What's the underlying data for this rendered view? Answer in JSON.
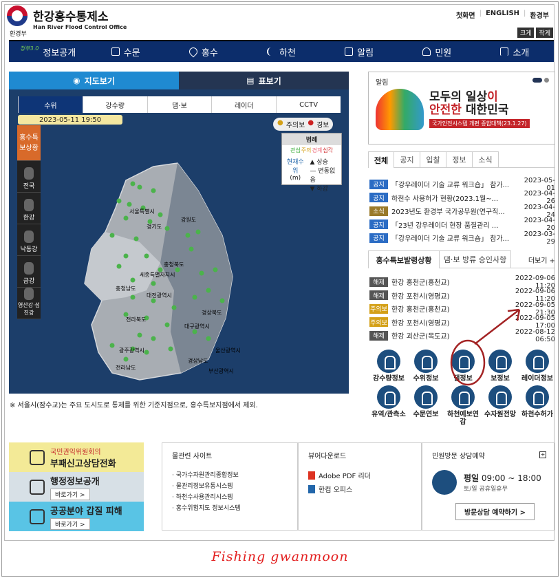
{
  "header": {
    "ministry": "환경부",
    "title_ko": "한강홍수통제소",
    "title_en": "Han River Flood Control Office"
  },
  "topnav": {
    "home": "첫화면",
    "english": "ENGLISH",
    "ministry": "환경부",
    "size_up": "크게",
    "size_down": "작게"
  },
  "gnb": {
    "open_small": "정부3.0",
    "items": [
      "정보공개",
      "수문",
      "홍수",
      "하천",
      "알림",
      "민원",
      "소개"
    ]
  },
  "map": {
    "tab_map": "지도보기",
    "tab_table": "표보기",
    "subtabs": [
      "수위",
      "강수량",
      "댐·보",
      "레이더",
      "CCTV"
    ],
    "datetime": "2023-05-11 19:50",
    "alert_attention": "주의보",
    "alert_warning": "경보",
    "legend": {
      "title": "범례",
      "levels": [
        "관심",
        "주의",
        "경계",
        "심각"
      ],
      "current": "현재수위",
      "unit": "(m)",
      "up": "▲ 상승",
      "same": "— 변동없음",
      "down": "▼ 하강"
    },
    "side": [
      "홍수특보상황",
      "전국",
      "한강",
      "낙동강",
      "금강",
      "영산강·섬진강"
    ],
    "regions": [
      "서울특별시",
      "경기도",
      "강원도",
      "충청북도",
      "충청남도",
      "세종특별자치시",
      "대전광역시",
      "경상북도",
      "대구광역시",
      "전라북도",
      "울산광역시",
      "광주광역시",
      "경상남도",
      "부산광역시",
      "전라남도"
    ],
    "footnote": "※ 서울시(잠수교)는 주요 도시도로 통제를 위한 기준지점으로, 홍수특보지점에서 제외."
  },
  "banner": {
    "title": "알림",
    "line1a": "모두의 일상",
    "line1b": "이",
    "line2a": "안전한",
    "line2b": " 대한민국",
    "sub": "국가안전시스템 개편 종합대책(23.1.27)"
  },
  "notice": {
    "tabs": [
      "전체",
      "공지",
      "입찰",
      "정보",
      "소식"
    ],
    "items": [
      {
        "tag": "공지",
        "title": "「강우레이더 기술 교류 워크숍」 참가...",
        "date": "2023-05-01"
      },
      {
        "tag": "공지",
        "title": "하천수 사용허가 현황(2023.1월~...",
        "date": "2023-04-26"
      },
      {
        "tag": "소식",
        "title": "2023년도 환경부 국가공무원(연구직...",
        "date": "2023-04-24"
      },
      {
        "tag": "공지",
        "title": "「23년 강우레이더 현장 품질관리 ...",
        "date": "2023-04-20"
      },
      {
        "tag": "공지",
        "title": "「강우레이더 기술 교류 워크숍」 참가...",
        "date": "2023-03-29"
      }
    ]
  },
  "flood": {
    "tab1": "홍수특보발령상황",
    "tab2": "댐·보 방류 승인사항",
    "more": "더보기 +",
    "items": [
      {
        "tag": "해제",
        "title": "한강 홍천군(홍천교)",
        "date": "2022-09-06 11:20"
      },
      {
        "tag": "해제",
        "title": "한강 포천시(영평교)",
        "date": "2022-09-06 11:20"
      },
      {
        "tag": "주의보",
        "title": "한강 홍천군(홍천교)",
        "date": "2022-09-05 21:30"
      },
      {
        "tag": "주의보",
        "title": "한강 포천시(영평교)",
        "date": "2022-09-05 17:00"
      },
      {
        "tag": "해제",
        "title": "한강 괴산군(목도교)",
        "date": "2022-08-12 06:50"
      }
    ]
  },
  "quick": [
    "강수량정보",
    "수위정보",
    "댐정보",
    "보정보",
    "레이더정보",
    "유역/관측소",
    "수문연보",
    "하천예보연감",
    "수자원전망",
    "하천수허가"
  ],
  "bottom": {
    "b1_sub": "국민권익위원회의",
    "b1_title": "부패신고상담전화",
    "b2_title": "행정정보공개",
    "b2_go": "바로가기 >",
    "b3_title": "공공분야 갑질 피해",
    "b3_go": "바로가기 >",
    "sites_title": "물관련 사이트",
    "sites": [
      "국가수자원관리종합정보",
      "물관리정보유통시스템",
      "하천수사용관리시스템",
      "홍수위험지도 정보시스템"
    ],
    "viewer_title": "뷰어다운로드",
    "viewer1": "Adobe PDF 리더",
    "viewer2": "한컴 오피스",
    "visit_title": "민원방문 상담예약",
    "visit_day": "평일",
    "visit_time": "09:00 ~ 18:00",
    "visit_off": "토/일 공휴일휴무",
    "visit_btn": "방문상담 예약하기 >"
  },
  "signature": "Fishing   gwanmoon",
  "colors": {
    "navy": "#0c2d6b",
    "map_bg": "#1c3e6a",
    "tag_notice": "#2b6cc4",
    "tag_news": "#9a7a2a",
    "tag_release": "#555",
    "tag_attention": "#d4a017",
    "annotation": "#a32324"
  }
}
